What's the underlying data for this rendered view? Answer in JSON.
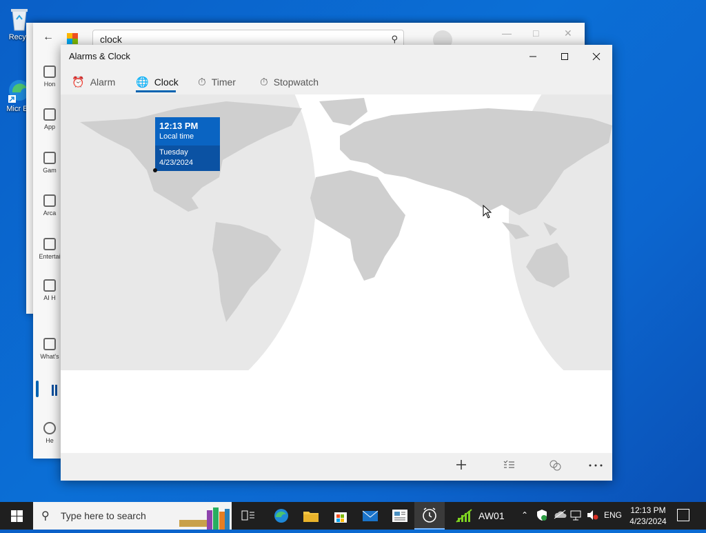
{
  "desktop": {
    "icons": [
      {
        "label": "Recycle Bin",
        "visible_label": "Recyc"
      },
      {
        "label": "Microsoft Edge",
        "visible_label": "Micr Ed"
      }
    ]
  },
  "store_window": {
    "search_value": "clock",
    "side_items": [
      "Home",
      "Apps",
      "Gaming",
      "Arcade",
      "Entertainment",
      "AI Hub",
      "What's new",
      "Help"
    ],
    "side_visible": [
      "Hon",
      "App",
      "Gam",
      "Arca",
      "Entertai",
      "AI H",
      "What's",
      "He"
    ]
  },
  "clock_window": {
    "title": "Alarms & Clock",
    "tabs": [
      {
        "label": "Alarm",
        "active": false
      },
      {
        "label": "Clock",
        "active": true
      },
      {
        "label": "Timer",
        "active": false
      },
      {
        "label": "Stopwatch",
        "active": false
      }
    ],
    "tooltip": {
      "time": "12:13 PM",
      "label": "Local time",
      "day": "Tuesday",
      "date": "4/23/2024"
    },
    "colors": {
      "accent": "#0063b1",
      "tooltip_top": "#0a64c2",
      "tooltip_bottom": "#0b52a3",
      "land": "#d6d6d6"
    }
  },
  "taskbar": {
    "search_placeholder": "Type here to search",
    "pinned_app_label": "AW01",
    "lang": "ENG",
    "time": "12:13 PM",
    "date": "4/23/2024"
  }
}
